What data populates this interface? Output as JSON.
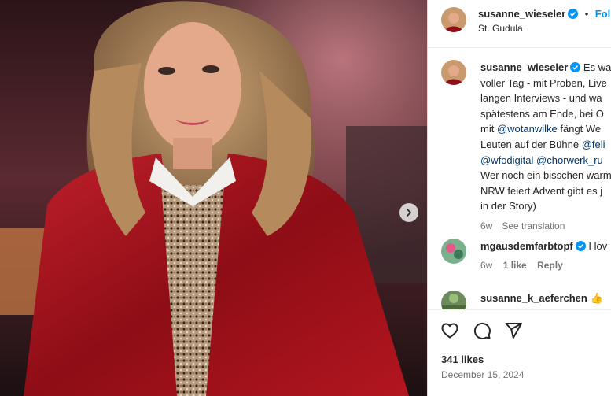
{
  "post_header": {
    "username": "susanne_wieseler",
    "separator": "•",
    "follow_label": "Follow",
    "location": "St. Gudula"
  },
  "caption": {
    "username": "susanne_wieseler",
    "lines": [
      "Es war",
      "voller Tag - mit Proben, Live",
      "langen Interviews - und wa",
      "spätestens am Ende, bei O",
      "mit",
      "fängt We",
      "Leuten auf der Bühne",
      "Wer noch ein bisschen warm",
      "NRW feiert Advent gibt es j",
      "in der Story)"
    ],
    "mentions": [
      "@wotanwilke",
      "@feli",
      "@wfodigital",
      "@chorwerk_ru"
    ],
    "age": "6w",
    "see_translation": "See translation"
  },
  "comments": [
    {
      "username": "mgausdemfarbtopf",
      "text": "I lov",
      "age": "6w",
      "likes": "1 like",
      "reply": "Reply"
    },
    {
      "username": "susanne_k_aeferchen",
      "text": "👍"
    }
  ],
  "footer": {
    "likes": "341 likes",
    "date": "December 15, 2024"
  },
  "icons": {
    "verified": "verified-badge-icon",
    "like": "heart-icon",
    "comment": "comment-icon",
    "share": "share-icon",
    "next": "chevron-right-icon"
  },
  "colors": {
    "accent": "#0095f6",
    "verified": "#0095f6",
    "link": "#00376b",
    "text": "#262626",
    "muted": "#737373"
  }
}
